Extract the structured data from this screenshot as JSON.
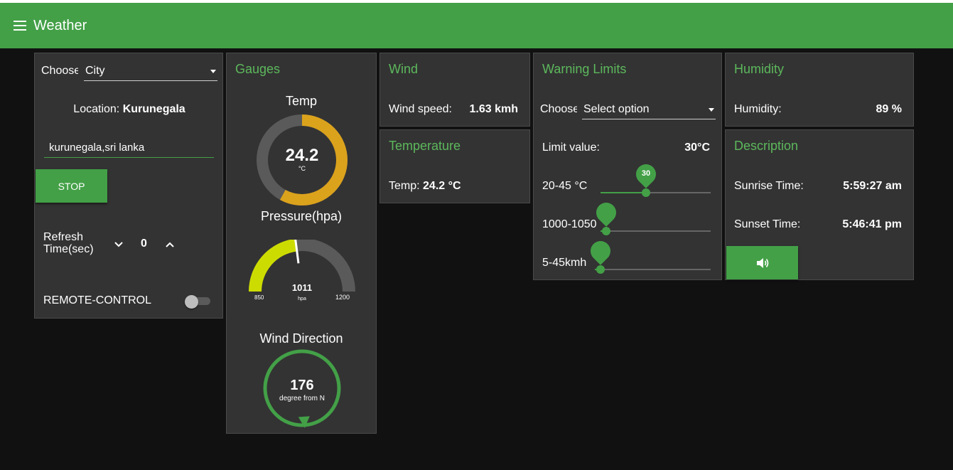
{
  "header": {
    "title": "Weather",
    "menu_icon": "menu-icon"
  },
  "controls": {
    "choose_label": "Choose",
    "city_select": "City",
    "location_label": "Location:",
    "location_value": "Kurunegala",
    "search_value": "kurunegala,sri lanka",
    "stop_label": "STOP",
    "refresh_label_1": "Refresh",
    "refresh_label_2": "Time(sec)",
    "refresh_value": "0",
    "remote_label": "REMOTE-CONTROL"
  },
  "gauges": {
    "title": "Gauges",
    "temp": {
      "title": "Temp",
      "value": "24.2",
      "unit": "°C",
      "fraction": 0.58
    },
    "pressure": {
      "title": "Pressure(hpa)",
      "value": "1011",
      "unit": "hpa",
      "min": "850",
      "max": "1200",
      "fraction": 0.46
    },
    "wind_direction": {
      "title": "Wind Direction",
      "value": "176",
      "unit": "degree from N",
      "degrees": 176
    }
  },
  "wind": {
    "title": "Wind",
    "speed_label": "Wind speed:",
    "speed_value": "1.63 kmh"
  },
  "temperature": {
    "title": "Temperature",
    "label": "Temp:",
    "value": "24.2 °C"
  },
  "warning": {
    "title": "Warning Limits",
    "choose_label": "Choose",
    "select_value": "Select option",
    "limit_label": "Limit value:",
    "limit_value": "30°C",
    "sliders": [
      {
        "label": "20-45 °C",
        "pin": "30",
        "fraction": 0.4
      },
      {
        "label": "1000-1050",
        "pin": "",
        "fraction": 0.0
      },
      {
        "label": "5-45kmh",
        "pin": "",
        "fraction": 0.0
      }
    ]
  },
  "humidity": {
    "title": "Humidity",
    "label": "Humidity:",
    "value": "89 %"
  },
  "description": {
    "title": "Description",
    "sunrise_label": "Sunrise Time:",
    "sunrise_value": "5:59:27 am",
    "sunset_label": "Sunset Time:",
    "sunset_value": "5:46:41 pm",
    "sound_icon": "volume-icon"
  },
  "colors": {
    "header": "#43a047",
    "accent": "#5cb85c",
    "temp_gauge": "#dba21c",
    "pressure_gauge": "#cddc00",
    "card": "#333333"
  }
}
